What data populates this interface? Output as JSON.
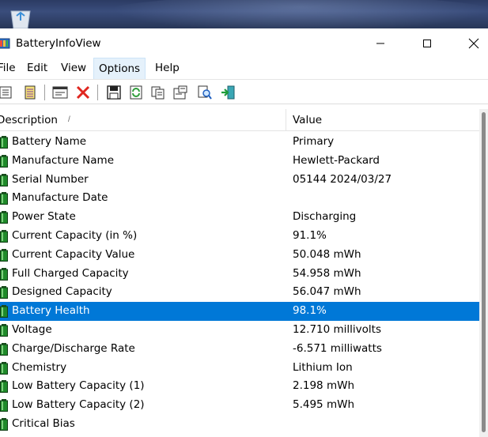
{
  "window": {
    "title": "BatteryInfoView",
    "minimize_icon": "minimize-icon",
    "maximize_icon": "maximize-icon",
    "close_icon": "close-icon"
  },
  "menu": {
    "items": [
      {
        "label": "File"
      },
      {
        "label": "Edit"
      },
      {
        "label": "View"
      },
      {
        "label": "Options"
      },
      {
        "label": "Help"
      }
    ]
  },
  "toolbar": {
    "buttons": [
      "battery-info-icon",
      "battery-log-icon",
      "properties-window-icon",
      "clear-icon",
      "save-icon",
      "refresh-icon",
      "copy-icon",
      "properties-icon",
      "find-icon",
      "exit-icon"
    ]
  },
  "list": {
    "columns": {
      "description": "Description",
      "value": "Value"
    },
    "sort_indicator": "/",
    "selected_index": 9,
    "rows": [
      {
        "description": "Battery Name",
        "value": "Primary"
      },
      {
        "description": "Manufacture Name",
        "value": "Hewlett-Packard"
      },
      {
        "description": "Serial Number",
        "value": "05144 2024/03/27"
      },
      {
        "description": "Manufacture Date",
        "value": ""
      },
      {
        "description": "Power State",
        "value": "Discharging"
      },
      {
        "description": "Current Capacity (in %)",
        "value": "91.1%"
      },
      {
        "description": "Current Capacity Value",
        "value": "50.048 mWh"
      },
      {
        "description": "Full Charged Capacity",
        "value": "54.958 mWh"
      },
      {
        "description": "Designed Capacity",
        "value": "56.047 mWh"
      },
      {
        "description": "Battery Health",
        "value": "98.1%"
      },
      {
        "description": "Voltage",
        "value": "12.710 millivolts"
      },
      {
        "description": "Charge/Discharge Rate",
        "value": "-6.571 milliwatts"
      },
      {
        "description": "Chemistry",
        "value": "Lithium Ion"
      },
      {
        "description": "Low Battery Capacity (1)",
        "value": "2.198 mWh"
      },
      {
        "description": "Low Battery Capacity (2)",
        "value": "5.495 mWh"
      },
      {
        "description": "Critical Bias",
        "value": ""
      }
    ]
  },
  "colors": {
    "selection": "#0078d7",
    "battery_green": "#1f8a2a"
  }
}
